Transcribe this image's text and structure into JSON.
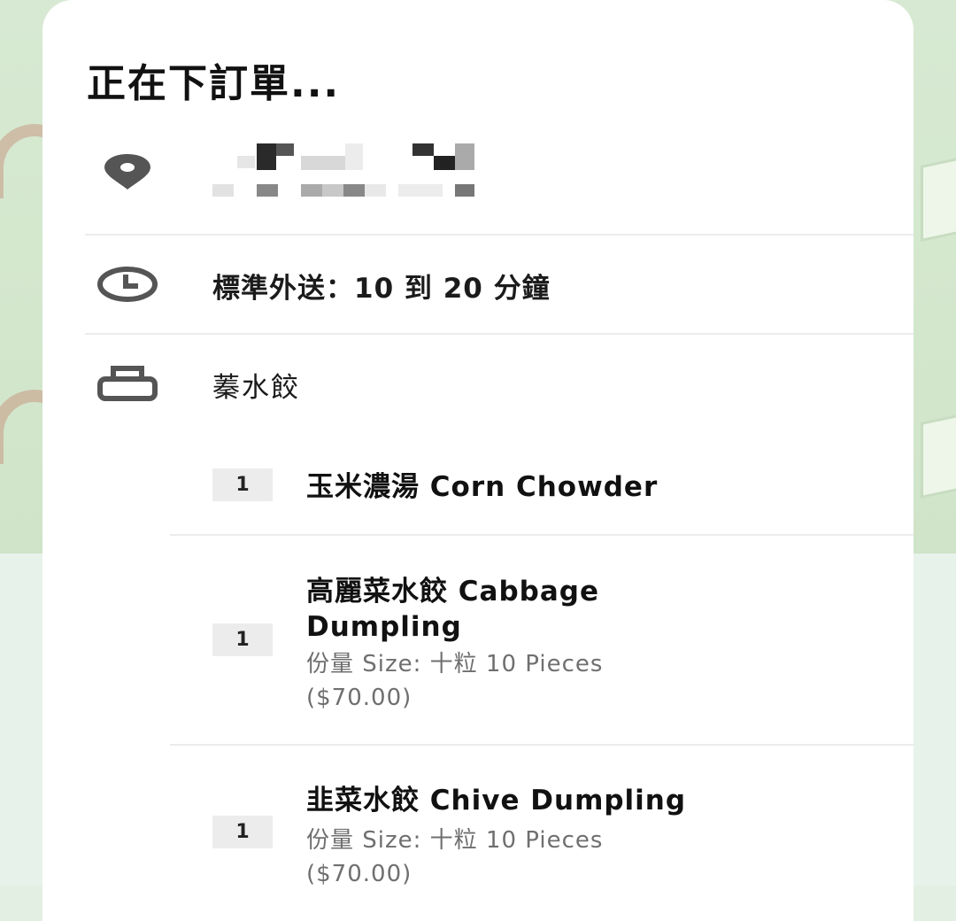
{
  "header": {
    "title": "正在下訂單..."
  },
  "address": {
    "icon": "location-pin-icon"
  },
  "delivery": {
    "icon": "clock-icon",
    "text": "標準外送：10 到 20 分鐘"
  },
  "store": {
    "icon": "shopping-bag-icon",
    "name": "蓁水餃"
  },
  "items": [
    {
      "qty": "1",
      "name": "玉米濃湯 Corn Chowder"
    },
    {
      "qty": "1",
      "name_line1": "高麗菜水餃 Cabbage",
      "name_line2": "Dumpling",
      "option_line1": "份量 Size: 十粒 10 Pieces",
      "option_line2": "($70.00)"
    },
    {
      "qty": "1",
      "name": "韭菜水餃 Chive Dumpling",
      "option_line1": "份量 Size: 十粒 10 Pieces",
      "option_line2": "($70.00)"
    }
  ]
}
